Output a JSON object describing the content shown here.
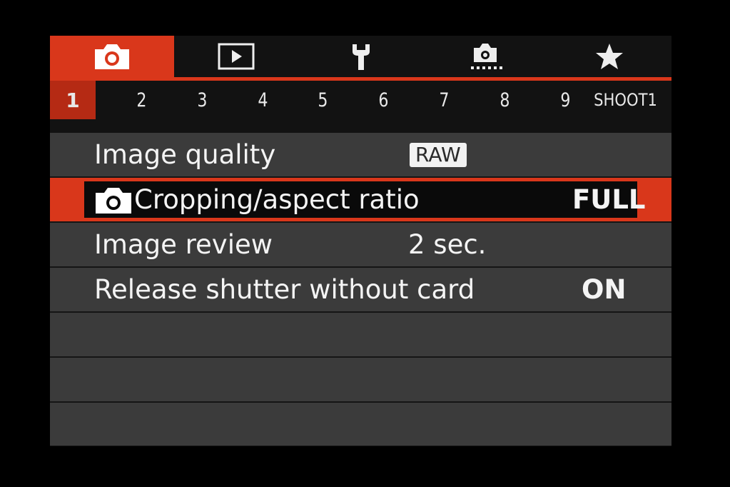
{
  "tabs": [
    {
      "icon": "camera-icon",
      "active": true
    },
    {
      "icon": "playback-icon",
      "active": false
    },
    {
      "icon": "wrench-icon",
      "active": false
    },
    {
      "icon": "custom-functions-icon",
      "active": false
    },
    {
      "icon": "star-icon",
      "active": false
    }
  ],
  "pages": [
    "1",
    "2",
    "3",
    "4",
    "5",
    "6",
    "7",
    "8",
    "9"
  ],
  "active_page": "1",
  "section_name": "SHOOT1",
  "menu": {
    "image_quality": {
      "label": "Image quality",
      "value": "RAW"
    },
    "cropping": {
      "label": "Cropping/aspect ratio",
      "value": "FULL"
    },
    "image_review": {
      "label": "Image review",
      "value": "2 sec."
    },
    "release_shutter": {
      "label": "Release shutter without card",
      "value": "ON"
    }
  },
  "colors": {
    "accent": "#d9371b",
    "row_bg": "#3b3b3b",
    "background": "#121212"
  }
}
